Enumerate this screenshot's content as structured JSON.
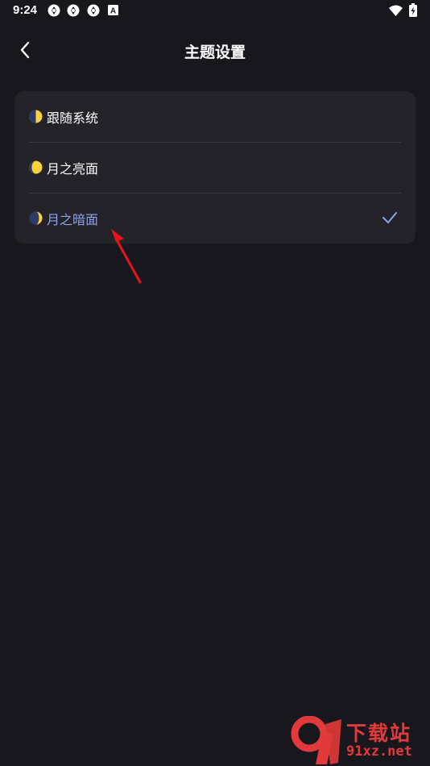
{
  "status_bar": {
    "time": "9:24",
    "notification_icons": [
      "app-notification-icon",
      "app-notification-icon",
      "app-notification-icon",
      "a-badge-icon"
    ],
    "a_badge": "A"
  },
  "header": {
    "title": "主题设置",
    "back_icon": "chevron-left-icon"
  },
  "theme_options": [
    {
      "label": "跟随系统",
      "icon": "half-moon-icon",
      "selected": false
    },
    {
      "label": "月之亮面",
      "icon": "bright-moon-icon",
      "selected": false
    },
    {
      "label": "月之暗面",
      "icon": "dark-moon-icon",
      "selected": true
    }
  ],
  "colors": {
    "background": "#18171d",
    "card": "#242329",
    "selected_text": "#8fa3ee",
    "annotation": "#e8141b"
  },
  "watermark": {
    "brand": "下载站",
    "site": "91xz.net",
    "logo_mark": "9"
  }
}
